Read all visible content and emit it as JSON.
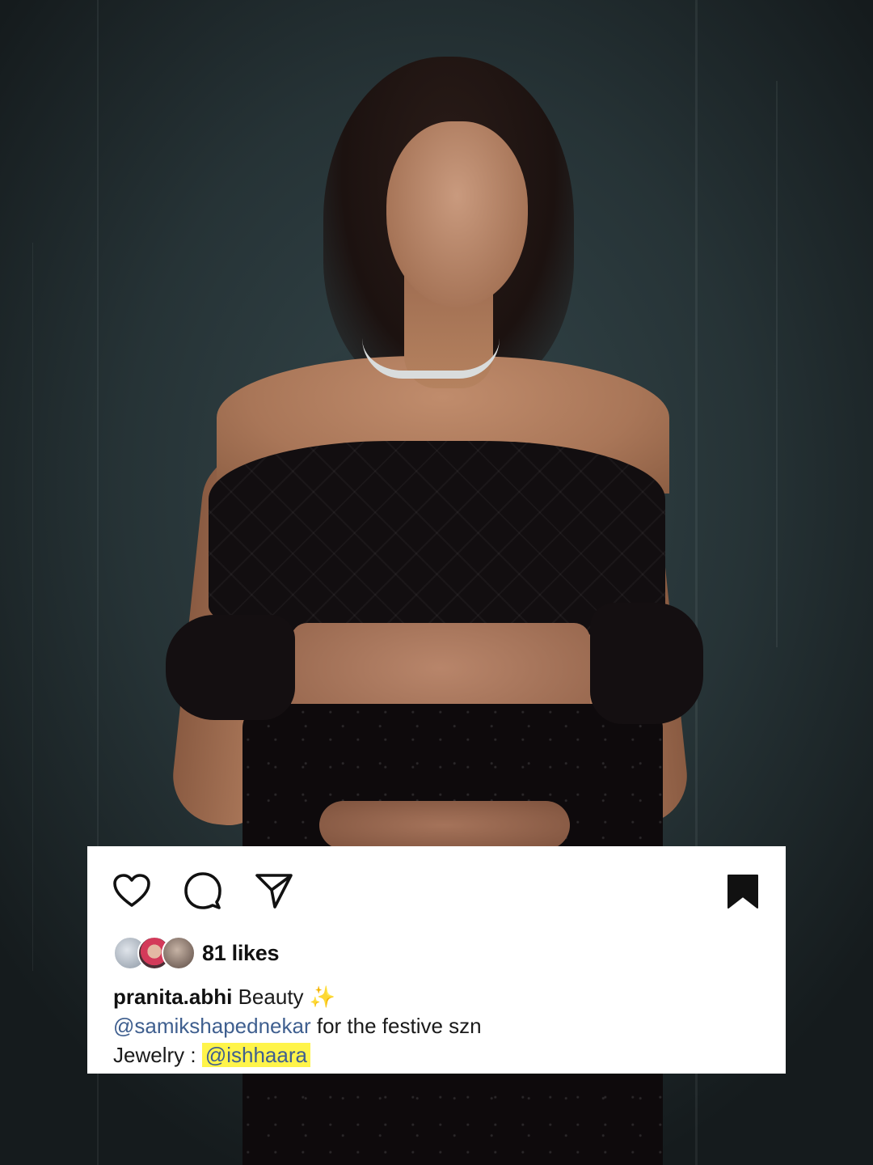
{
  "post": {
    "photo_icon": "portrait-photo",
    "actions": {
      "like_icon": "heart-icon",
      "comment_icon": "comment-icon",
      "share_icon": "paper-plane-icon",
      "save_icon": "bookmark-icon"
    },
    "likes": {
      "text": "81 likes"
    },
    "caption": {
      "username": "pranita.abhi",
      "text": "Beauty",
      "emoji": "✨",
      "line2_mention": "@samikshapednekar",
      "line2_text": " for the festive szn",
      "line3_label": "Jewelry : ",
      "line3_mention": "@ishhaara"
    },
    "colors": {
      "card_bg": "#ffffff",
      "mention": "#3f5f8f",
      "highlight": "#fff44a",
      "text": "#111111"
    }
  }
}
